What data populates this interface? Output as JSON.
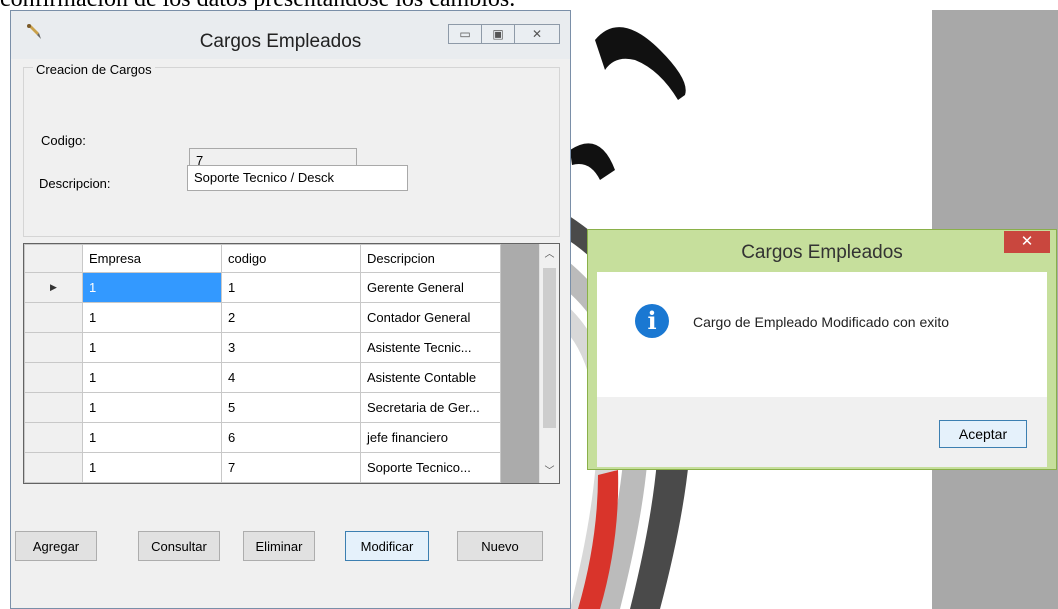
{
  "doc_fragment": "confirmación de los datos presentándose los cambios.",
  "main_window": {
    "title": "Cargos Empleados",
    "controls": {
      "minimize": "▭",
      "maximize": "▣",
      "close": "✕"
    },
    "group_title": "Creacion de Cargos",
    "fields": {
      "codigo_label": "Codigo:",
      "codigo_value": "7",
      "descripcion_label": "Descripcion:",
      "descripcion_value": "Soporte Tecnico / Desck"
    },
    "grid": {
      "columns": [
        "Empresa",
        "codigo",
        "Descripcion"
      ],
      "rows": [
        [
          "1",
          "1",
          "Gerente General"
        ],
        [
          "1",
          "2",
          "Contador General"
        ],
        [
          "1",
          "3",
          "Asistente Tecnic..."
        ],
        [
          "1",
          "4",
          "Asistente Contable"
        ],
        [
          "1",
          "5",
          "Secretaria de Ger..."
        ],
        [
          "1",
          "6",
          "jefe financiero"
        ],
        [
          "1",
          "7",
          "Soporte Tecnico..."
        ]
      ],
      "current_row_marker": "▶"
    },
    "buttons": {
      "agregar": "Agregar",
      "consultar": "Consultar",
      "eliminar": "Eliminar",
      "modificar": "Modificar",
      "nuevo": "Nuevo"
    }
  },
  "message_box": {
    "title": "Cargos Empleados",
    "close": "✕",
    "icon": "i",
    "text": "Cargo de Empleado Modificado con exito",
    "ok_button": "Aceptar"
  }
}
